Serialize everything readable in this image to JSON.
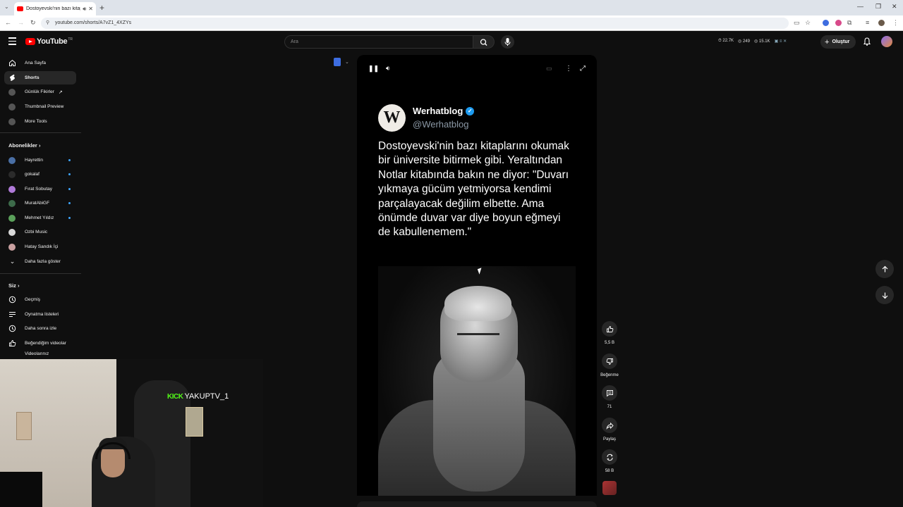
{
  "browser": {
    "tab_title": "Dostoyevski'nin bazı kitapla...",
    "url": "youtube.com/shorts/A7vZ1_4XZYs"
  },
  "header": {
    "logo_text": "YouTube",
    "logo_country": "TR",
    "search_placeholder": "Ara",
    "stats": [
      "22.7K",
      "249",
      "15.1K"
    ],
    "create_label": "Oluştur"
  },
  "sidebar": {
    "main_items": [
      {
        "label": "Ana Sayfa",
        "icon": "home-icon"
      },
      {
        "label": "Shorts",
        "icon": "shorts-icon"
      },
      {
        "label": "Günlük Fikirler",
        "icon": "channel-icon"
      },
      {
        "label": "Thumbnail Preview",
        "icon": "channel-icon"
      },
      {
        "label": "More Tools",
        "icon": "channel-icon"
      }
    ],
    "subscriptions_title": "Abonelikler",
    "subscriptions": [
      {
        "label": "Hayrettin",
        "color": "#4a6fa5"
      },
      {
        "label": "gokalaf",
        "color": "#2b2b2b"
      },
      {
        "label": "Fırat Sobutay",
        "color": "#b07ad8"
      },
      {
        "label": "MuratAbiGF",
        "color": "#3d6b4a"
      },
      {
        "label": "Mehmet Yıldız",
        "color": "#5aa05a"
      },
      {
        "label": "Ozbi Music",
        "color": "#d8d8d8"
      },
      {
        "label": "Hatay Sandık İçi",
        "color": "#c9a0a0"
      }
    ],
    "show_more": "Daha fazla göster",
    "you_title": "Siz",
    "you_items": [
      {
        "label": "Geçmiş",
        "icon": "history-icon"
      },
      {
        "label": "Oynatma listeleri",
        "icon": "playlist-icon"
      },
      {
        "label": "Daha sonra izle",
        "icon": "clock-icon"
      },
      {
        "label": "Beğendiğim videolar",
        "icon": "like-icon"
      },
      {
        "label": "Videolarınız",
        "icon": "video-icon"
      }
    ]
  },
  "overlay": {
    "kick_logo": "KICK",
    "kick_channel": "YAKUPTV_1"
  },
  "short": {
    "author_initial": "W",
    "author_name": "Werhatblog",
    "author_handle": "@Werhatblog",
    "text": "Dostoyevski'nin bazı kitaplarını okumak bir üniversite bitirmek gibi. Yeraltından Notlar kitabında bakın ne diyor: \"Duvarı yıkmaya gücüm yetmiyorsa kendimi parçalayacak değilim elbette. Ama önümde duvar var diye boyun eğmeyi de kabullenemem.\""
  },
  "actions": {
    "likes": "5,5 B",
    "dislike": "Beğenme",
    "comments": "71",
    "share": "Paylaş",
    "remix": "58 B"
  },
  "colors": {
    "background": "#0f0f0f",
    "brand_red": "#ff0000",
    "kick_green": "#53fc18",
    "verified_blue": "#1d9bf0"
  }
}
